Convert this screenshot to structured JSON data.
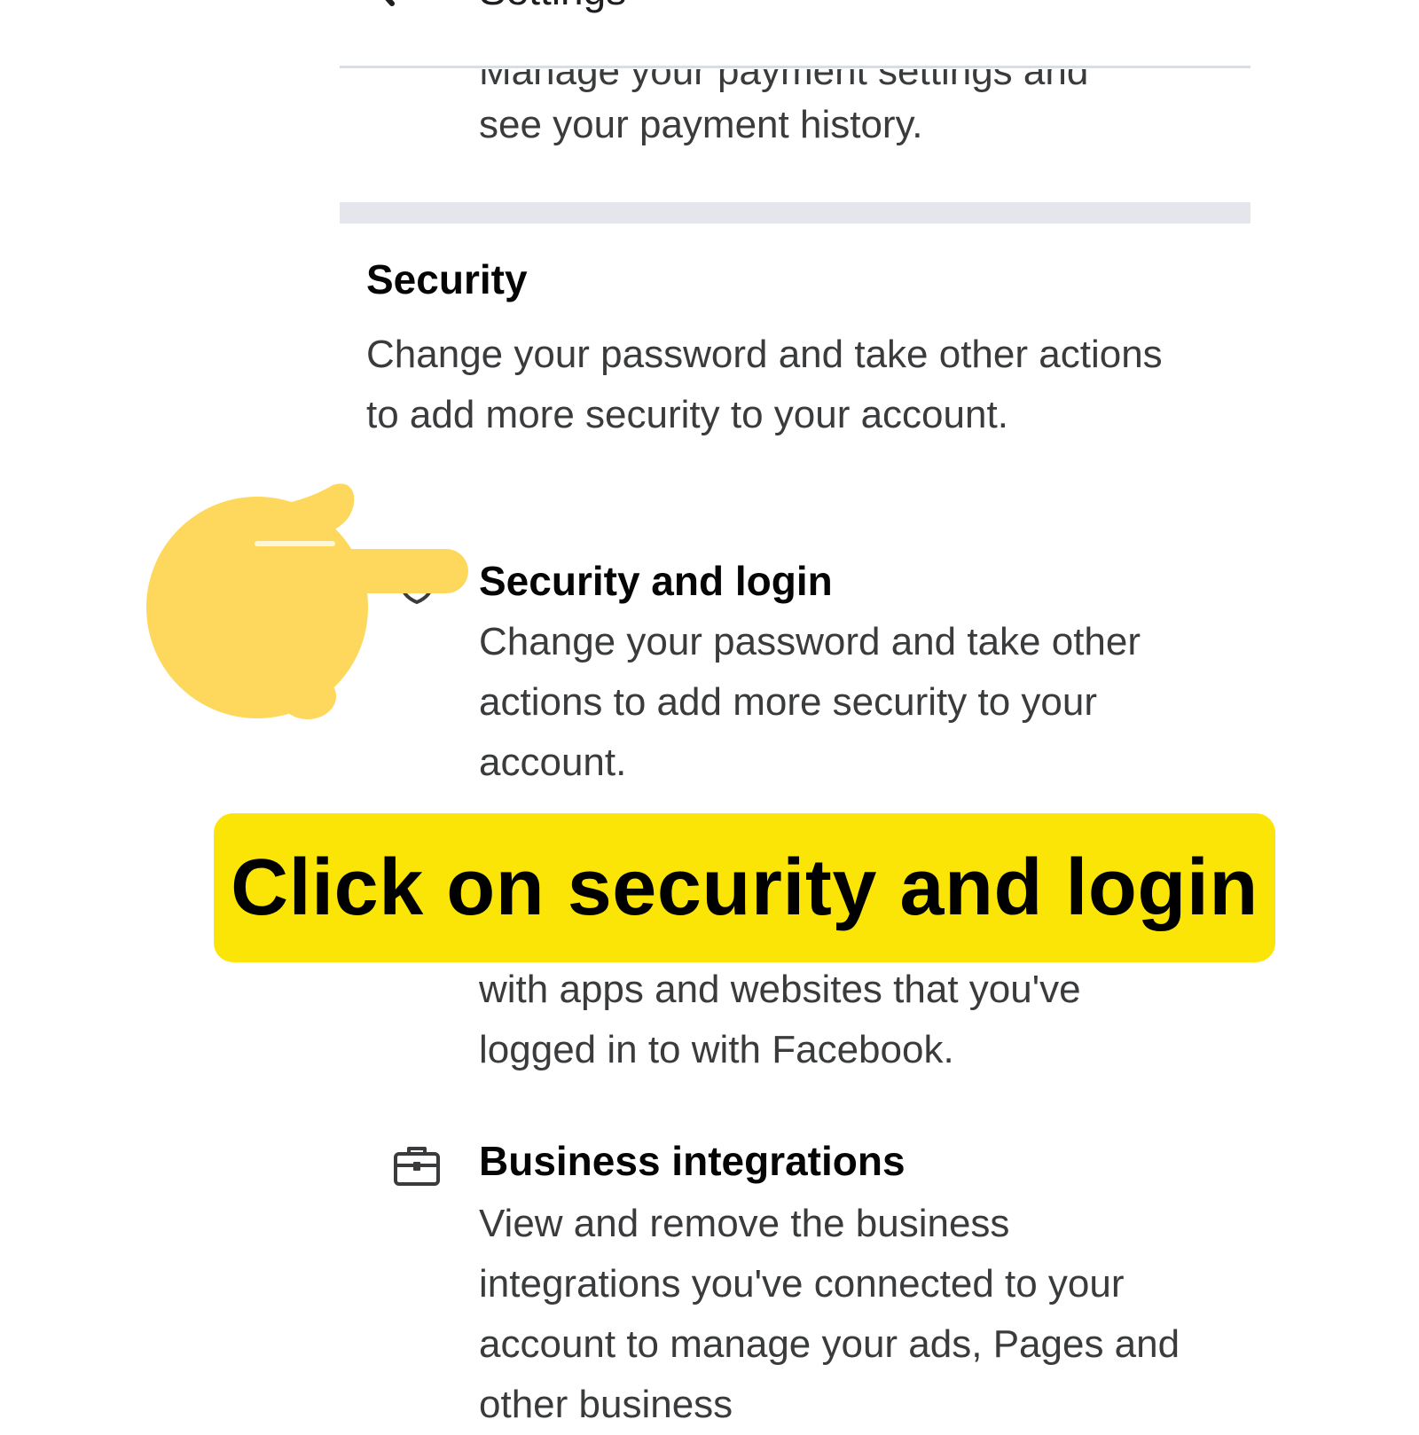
{
  "header": {
    "title": "Settings",
    "icon": "back-arrow-icon"
  },
  "payments": {
    "desc_line1_clipped": "Manage your payment settings and",
    "desc_line2": "see your payment history."
  },
  "security_section": {
    "title": "Security",
    "description": "Change your password and take other actions to add more security to your account."
  },
  "items": [
    {
      "icon": "shield-icon",
      "title": "Security and login",
      "description": "Change your password and take other actions to add more security to your account."
    },
    {
      "icon": "apps-icon",
      "title": "",
      "description": "with apps and websites that you've logged in to with Facebook."
    },
    {
      "icon": "briefcase-icon",
      "title": "Business integrations",
      "description": "View and remove the business integrations you've connected to your account to manage your ads, Pages and other business"
    }
  ],
  "banner": {
    "text": "Click on security and login",
    "color": "#fbe507"
  },
  "pointer": {
    "icon": "pointing-hand-icon",
    "color": "#fdd85d"
  }
}
